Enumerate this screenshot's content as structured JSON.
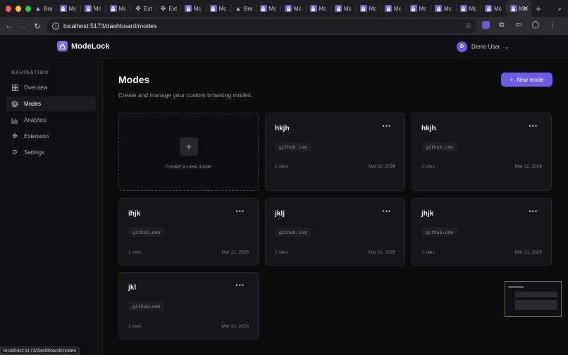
{
  "browser": {
    "tabs": [
      {
        "icon": "tri-icon",
        "label": "Bra"
      },
      {
        "icon": "lock-icon",
        "label": "Mc"
      },
      {
        "icon": "lock-icon",
        "label": "Mc"
      },
      {
        "icon": "lock-icon",
        "label": "Mc"
      },
      {
        "icon": "puzzle-icon",
        "label": "Ext"
      },
      {
        "icon": "puzzle-icon",
        "label": "Ext"
      },
      {
        "icon": "lock-icon",
        "label": "Mc"
      },
      {
        "icon": "lock-icon",
        "label": "Mc"
      },
      {
        "icon": "tri-icon",
        "label": "Bra"
      },
      {
        "icon": "lock-icon",
        "label": "Mc"
      },
      {
        "icon": "lock-icon",
        "label": "Mc"
      },
      {
        "icon": "lock-icon",
        "label": "Mc"
      },
      {
        "icon": "lock-icon",
        "label": "Mc"
      },
      {
        "icon": "lock-icon",
        "label": "Mc"
      },
      {
        "icon": "lock-icon",
        "label": "Mc"
      },
      {
        "icon": "lock-icon",
        "label": "Mc"
      },
      {
        "icon": "lock-icon",
        "label": "Mc"
      },
      {
        "icon": "lock-icon",
        "label": "Mc"
      },
      {
        "icon": "lock-icon",
        "label": "Mc"
      },
      {
        "icon": "lock-icon",
        "label": "Mc",
        "active": true
      }
    ],
    "url": "localhost:5173/dashboard/modes",
    "status_url": "localhost:5173/dashboard/modes"
  },
  "header": {
    "brand": "ModeLock",
    "user_initial": "D",
    "user_name": "Demo User"
  },
  "sidebar": {
    "heading": "NAVIGATION",
    "items": [
      {
        "label": "Overview",
        "icon": "grid-icon"
      },
      {
        "label": "Modes",
        "icon": "layers-icon",
        "active": true
      },
      {
        "label": "Analytics",
        "icon": "bar-chart-icon"
      },
      {
        "label": "Extension",
        "icon": "puzzle-icon"
      },
      {
        "label": "Settings",
        "icon": "gear-icon"
      }
    ]
  },
  "main": {
    "title": "Modes",
    "subtitle": "Create and manage your custom browsing modes",
    "new_button": "New mode",
    "create_card_label": "Create a new mode",
    "modes": [
      {
        "name": "hkjh",
        "domain": "github.com",
        "sites": "1 sites",
        "date": "Mar 22, 2026"
      },
      {
        "name": "hkjh",
        "domain": "github.com",
        "sites": "1 sites",
        "date": "Mar 22, 2026"
      },
      {
        "name": "ihjk",
        "domain": "github.com",
        "sites": "1 sites",
        "date": "Mar 21, 2026"
      },
      {
        "name": "jklj",
        "domain": "github.com",
        "sites": "1 sites",
        "date": "Mar 21, 2026"
      },
      {
        "name": "jhjk",
        "domain": "github.com",
        "sites": "1 sites",
        "date": "Mar 21, 2026"
      },
      {
        "name": "jkl",
        "domain": "github.com",
        "sites": "1 sites",
        "date": "Mar 21, 2026"
      }
    ]
  },
  "colors": {
    "accent": "#6c5ce7",
    "background": "#0b0b0c",
    "card": "#161618"
  }
}
